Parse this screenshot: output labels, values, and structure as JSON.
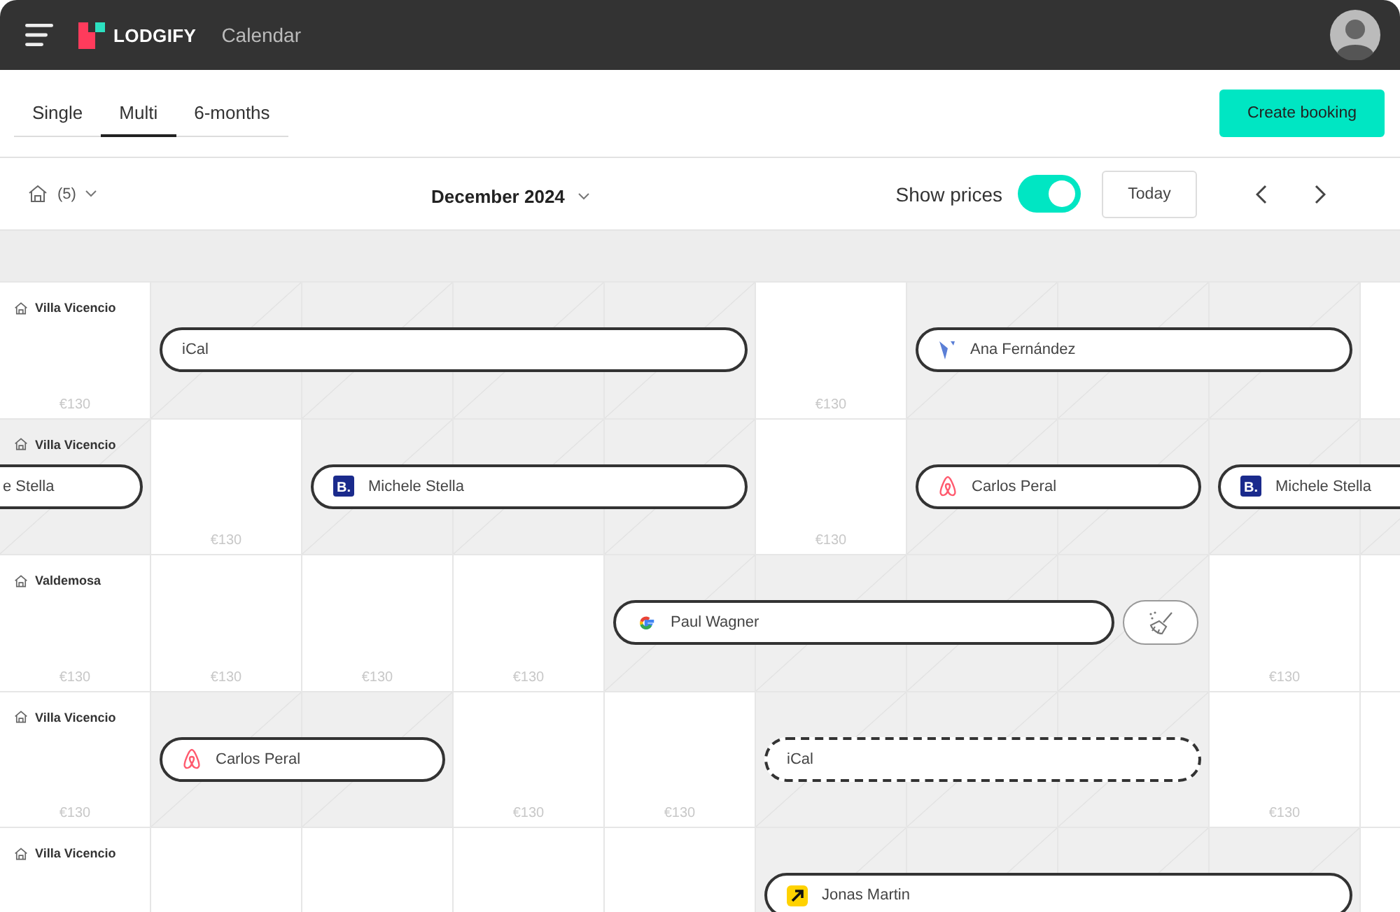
{
  "topbar": {
    "brand": "LODGIFY",
    "section": "Calendar"
  },
  "tabs": [
    {
      "label": "Single",
      "selected": false
    },
    {
      "label": "Multi",
      "selected": true
    },
    {
      "label": "6-months",
      "selected": false
    }
  ],
  "create_button": "Create booking",
  "toolbar": {
    "properties_count": "(5)",
    "month": "December 2024",
    "show_prices": {
      "label": "Show prices",
      "on": true
    },
    "today": "Today"
  },
  "rows": [
    {
      "property": "Villa Vicencio",
      "cells": [
        {
          "kind": "free",
          "price": "€130"
        },
        {
          "kind": "booked",
          "booking": {
            "name": "iCal",
            "confirmed": true
          }
        },
        {
          "kind": "booked"
        },
        {
          "kind": "booked"
        },
        {
          "kind": "booked"
        },
        {
          "kind": "free",
          "price": "€130"
        },
        {
          "kind": "booked",
          "booking": {
            "name": "Ana Fernández",
            "source": {
              "kind": "v"
            },
            "confirmed": true
          }
        },
        {
          "kind": "booked"
        },
        {
          "kind": "booked"
        },
        {
          "kind": "free"
        }
      ]
    },
    {
      "property": "Villa Vicencio",
      "cells": [
        {
          "kind": "booked",
          "booking": {
            "name": "e Stella",
            "continued": true,
            "confirmed": true
          }
        },
        {
          "kind": "free",
          "price": "€130"
        },
        {
          "kind": "booked",
          "booking": {
            "name": "Michele Stella",
            "source": {
              "kind": "letter",
              "text": "B."
            },
            "confirmed": true
          }
        },
        {
          "kind": "booked"
        },
        {
          "kind": "booked"
        },
        {
          "kind": "free",
          "price": "€130"
        },
        {
          "kind": "booked",
          "booking": {
            "name": "Carlos Peral",
            "source": {
              "kind": "loop"
            },
            "confirmed": true
          }
        },
        {
          "kind": "booked"
        },
        {
          "kind": "booked",
          "booking": {
            "name": "Michele Stella",
            "source": {
              "kind": "letter",
              "text": "B."
            },
            "confirmed": true
          }
        },
        {
          "kind": "booked"
        }
      ]
    },
    {
      "property": "Valdemosa",
      "cells": [
        {
          "kind": "free",
          "price": "€130"
        },
        {
          "kind": "free",
          "price": "€130"
        },
        {
          "kind": "free",
          "price": "€130"
        },
        {
          "kind": "free",
          "price": "€130"
        },
        {
          "kind": "booked",
          "booking": {
            "name": "Paul Wagner",
            "source": {
              "kind": "g"
            },
            "confirmed": true,
            "cleaning": true
          }
        },
        {
          "kind": "booked"
        },
        {
          "kind": "booked"
        },
        {
          "kind": "booked"
        },
        {
          "kind": "free",
          "price": "€130"
        },
        {
          "kind": "free"
        }
      ]
    },
    {
      "property": "Villa Vicencio",
      "cells": [
        {
          "kind": "free",
          "price": "€130"
        },
        {
          "kind": "booked",
          "booking": {
            "name": "Carlos Peral",
            "source": {
              "kind": "loop"
            },
            "confirmed": true
          }
        },
        {
          "kind": "booked"
        },
        {
          "kind": "free",
          "price": "€130"
        },
        {
          "kind": "free",
          "price": "€130"
        },
        {
          "kind": "booked",
          "booking": {
            "name": "iCal",
            "confirmed": false
          }
        },
        {
          "kind": "booked"
        },
        {
          "kind": "booked"
        },
        {
          "kind": "free",
          "price": "€130"
        },
        {
          "kind": "free"
        }
      ]
    },
    {
      "property": "Villa Vicencio",
      "cells": [
        {
          "kind": "free"
        },
        {
          "kind": "free"
        },
        {
          "kind": "free"
        },
        {
          "kind": "free"
        },
        {
          "kind": "free"
        },
        {
          "kind": "booked",
          "booking": {
            "name": "Jonas Martin",
            "source": {
              "kind": "arrow"
            },
            "confirmed": true
          }
        },
        {
          "kind": "booked"
        },
        {
          "kind": "booked"
        },
        {
          "kind": "booked"
        },
        {
          "kind": "free"
        }
      ]
    }
  ]
}
